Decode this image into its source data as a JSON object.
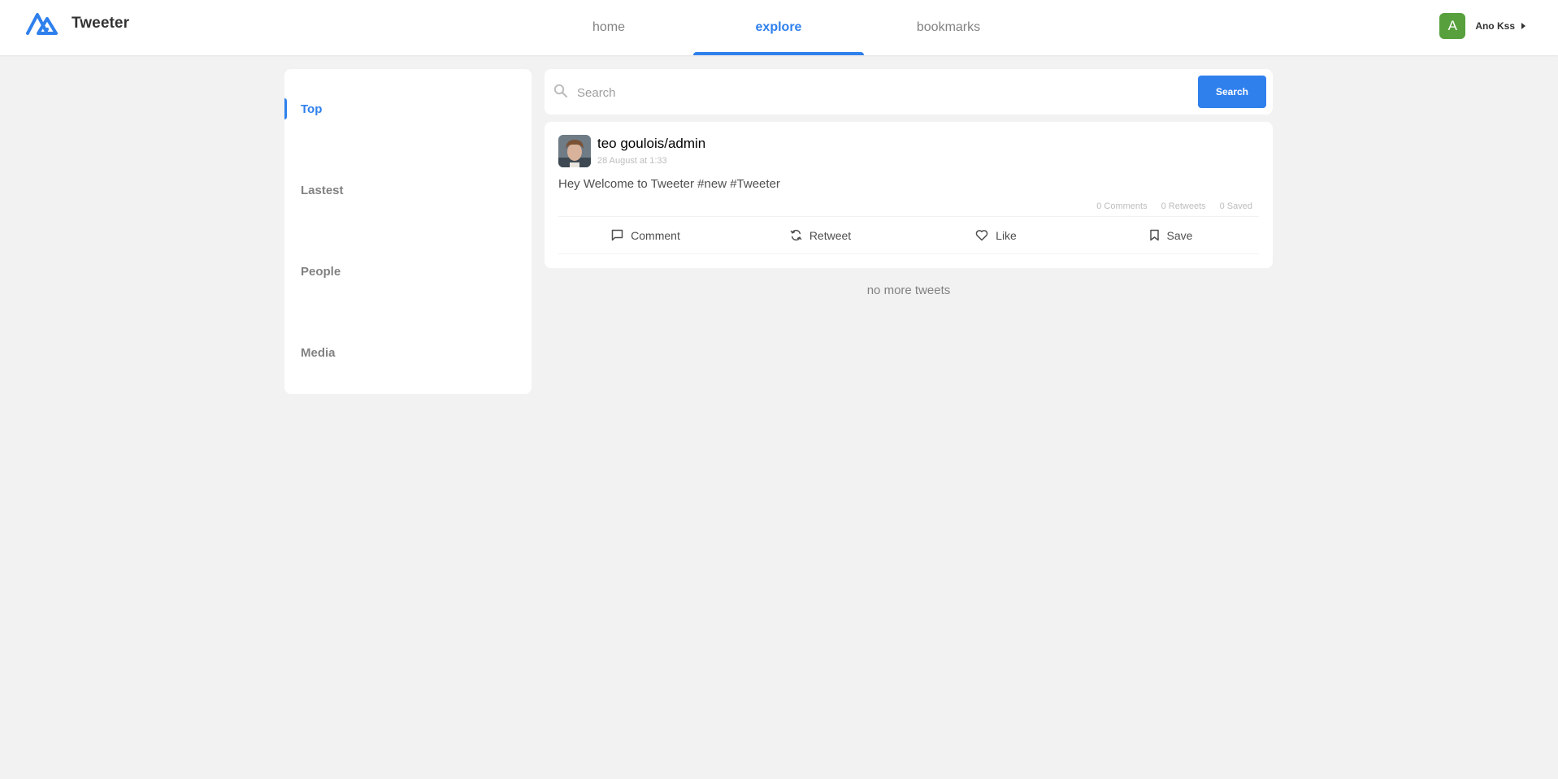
{
  "brand": {
    "name": "Tweeter",
    "accent_color": "#2f80ed"
  },
  "nav": {
    "tabs": [
      {
        "label": "home",
        "active": false
      },
      {
        "label": "explore",
        "active": true
      },
      {
        "label": "bookmarks",
        "active": false
      }
    ]
  },
  "user": {
    "initial": "A",
    "name": "Ano Kss",
    "avatar_color": "#57a03d"
  },
  "filters": {
    "items": [
      {
        "label": "Top",
        "active": true
      },
      {
        "label": "Lastest",
        "active": false
      },
      {
        "label": "People",
        "active": false
      },
      {
        "label": "Media",
        "active": false
      }
    ]
  },
  "search": {
    "placeholder": "Search",
    "value": "",
    "button_label": "Search"
  },
  "tweets": [
    {
      "author": "teo goulois/admin",
      "date": "28 August at 1:33",
      "text": "Hey Welcome to Tweeter #new #Tweeter",
      "stats": {
        "comments": "0 Comments",
        "retweets": "0 Retweets",
        "saved": "0 Saved"
      },
      "actions": {
        "comment": "Comment",
        "retweet": "Retweet",
        "like": "Like",
        "save": "Save"
      }
    }
  ],
  "feed": {
    "end_message": "no more tweets"
  }
}
